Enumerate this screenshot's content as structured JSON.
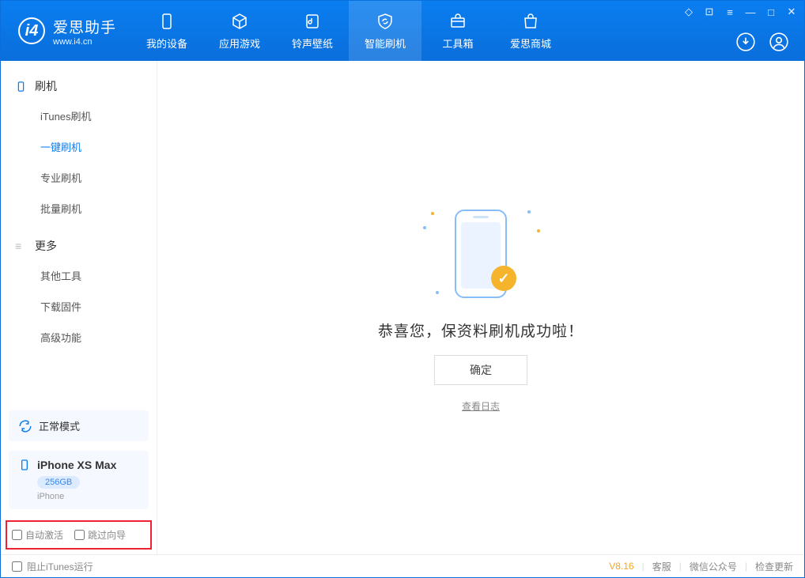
{
  "logo": {
    "cn": "爱思助手",
    "en": "www.i4.cn"
  },
  "nav": {
    "items": [
      {
        "label": "我的设备"
      },
      {
        "label": "应用游戏"
      },
      {
        "label": "铃声壁纸"
      },
      {
        "label": "智能刷机"
      },
      {
        "label": "工具箱"
      },
      {
        "label": "爱思商城"
      }
    ]
  },
  "sidebar": {
    "group1": {
      "title": "刷机",
      "items": [
        "iTunes刷机",
        "一键刷机",
        "专业刷机",
        "批量刷机"
      ]
    },
    "group2": {
      "title": "更多",
      "items": [
        "其他工具",
        "下载固件",
        "高级功能"
      ]
    },
    "mode": "正常模式",
    "device": {
      "name": "iPhone XS Max",
      "storage": "256GB",
      "type": "iPhone"
    },
    "checks": {
      "a": "自动激活",
      "b": "跳过向导"
    }
  },
  "main": {
    "message": "恭喜您，保资料刷机成功啦！",
    "ok": "确定",
    "log": "查看日志"
  },
  "footer": {
    "stop_itunes": "阻止iTunes运行",
    "version": "V8.16",
    "links": [
      "客服",
      "微信公众号",
      "检查更新"
    ]
  }
}
